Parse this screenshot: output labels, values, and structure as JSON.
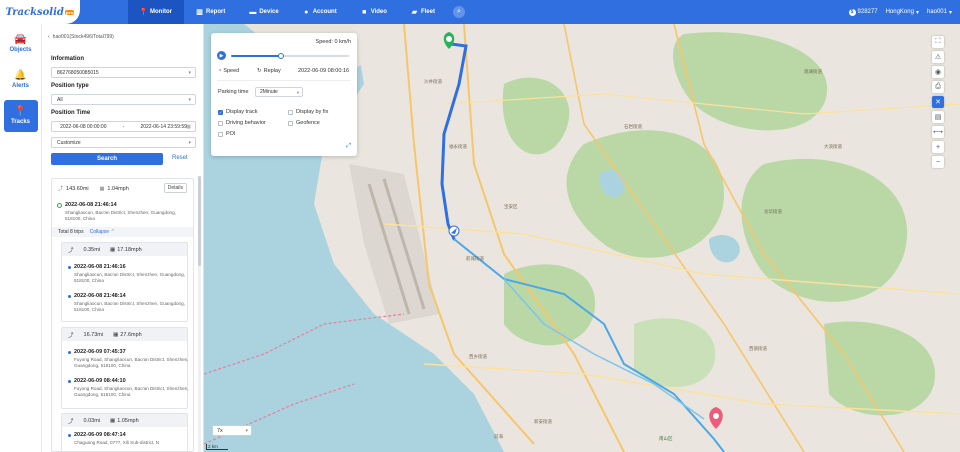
{
  "header": {
    "brand": "Tracksolid",
    "brand_badge": "pro",
    "nav": [
      {
        "label": "Monitor",
        "icon": "pin-icon",
        "active": true
      },
      {
        "label": "Report",
        "icon": "chart-icon",
        "active": false
      },
      {
        "label": "Device",
        "icon": "car-icon",
        "active": false
      },
      {
        "label": "Account",
        "icon": "user-icon",
        "active": false
      },
      {
        "label": "Video",
        "icon": "video-icon",
        "active": false
      },
      {
        "label": "Fleet",
        "icon": "truck-icon",
        "active": false
      }
    ],
    "balance": "928277",
    "timezone": "HongKong",
    "user": "hao001"
  },
  "rail": [
    {
      "label": "Objects",
      "icon": "car-icon",
      "active": false
    },
    {
      "label": "Alerts",
      "icon": "bell-icon",
      "active": false
    },
    {
      "label": "Tracks",
      "icon": "pin-icon",
      "active": true
    }
  ],
  "panel": {
    "breadcrumb": "hao001(Stock496/Total799)",
    "info_label": "Information",
    "device": "862768050085015",
    "position_type_label": "Position type",
    "position_type": "All",
    "position_time_label": "Position Time",
    "start_time": "2022-06-08 00:00:00",
    "time_sep": "-",
    "end_time": "2022-06-14 23:59:59",
    "range_mode": "Customize",
    "search_label": "Search",
    "reset_label": "Reset",
    "summary": {
      "distance": "143.60mi",
      "speed": "1.04mph",
      "details_label": "Details",
      "start_time": "2022-06-08 21:46:14",
      "start_addr": "Shangliaocun, Bao'an District, Shenzhen, Guangdong, 518100, China",
      "total_trips": "Total 8 trips",
      "collapse_label": "Collapse"
    },
    "trips": [
      {
        "distance": "0.35mi",
        "speed": "17.18mph",
        "start_time": "2022-06-08 21:46:16",
        "start_addr": "Shangliaocun, Bao'an District, Shenzhen, Guangdong, 518100, China",
        "end_time": "2022-06-08 21:48:14",
        "end_addr": "Shangliaocun, Bao'an District, Shenzhen, Guangdong, 518100, China"
      },
      {
        "distance": "16.73mi",
        "speed": "27.6mph",
        "start_time": "2022-06-09 07:45:37",
        "start_addr": "Fuyong Road, Shangliaocun, Bao'an District, Shenzhen, Guangdong, 518100, China",
        "end_time": "2022-06-09 08:44:10",
        "end_addr": "Fuyong Road, Shangliaocun, Bao'an District, Shenzhen, Guangdong, 518100, China"
      },
      {
        "distance": "0.03mi",
        "speed": "1.05mph",
        "start_time": "2022-06-09 08:47:14",
        "start_addr": "Chaguang Road, 07??, Xili Sub-district, N"
      }
    ]
  },
  "playback": {
    "speed_label": "Speed: 0 km/h",
    "progress": 0.42,
    "speed_ctrl": "Speed",
    "replay_label": "Replay",
    "current_time": "2022-06-09 08:00:16",
    "parking_label": "Parking time",
    "parking_value": "2Minute",
    "options": [
      {
        "label": "Display track",
        "checked": true
      },
      {
        "label": "Display by fix",
        "checked": false
      },
      {
        "label": "Driving behavior",
        "checked": false
      },
      {
        "label": "Geofence",
        "checked": false
      },
      {
        "label": "POI",
        "checked": false
      }
    ]
  },
  "map": {
    "zoom_select": "7x",
    "scale": "2 km",
    "labels": [
      "福永街道",
      "沙井街道",
      "西乡街道",
      "航城街道",
      "石岩街道",
      "大浪街道",
      "观澜街道",
      "龙华街道",
      "新安街道",
      "西丽街道",
      "前海",
      "南山区",
      "宝安区"
    ]
  }
}
